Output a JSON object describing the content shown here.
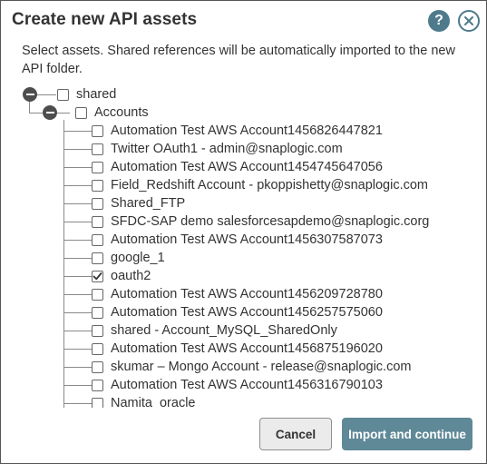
{
  "dialog": {
    "title": "Create new API assets",
    "description": "Select assets. Shared references will be automatically imported to the new API folder.",
    "help_icon": "question-mark-icon",
    "close_icon": "close-circle-icon"
  },
  "tree": {
    "root": {
      "label": "shared",
      "expanded": true,
      "checked": false
    },
    "folder": {
      "label": "Accounts",
      "expanded": true,
      "checked": false
    },
    "items": [
      {
        "label": "Automation Test AWS Account1456826447821",
        "checked": false
      },
      {
        "label": "Twitter OAuth1 - admin@snaplogic.com",
        "checked": false
      },
      {
        "label": "Automation Test AWS Account1454745647056",
        "checked": false
      },
      {
        "label": "Field_Redshift Account - pkoppishetty@snaplogic.com",
        "checked": false
      },
      {
        "label": "Shared_FTP",
        "checked": false
      },
      {
        "label": "SFDC-SAP demo salesforcesapdemo@snaplogic.corg",
        "checked": false
      },
      {
        "label": "Automation Test AWS Account1456307587073",
        "checked": false
      },
      {
        "label": "google_1",
        "checked": false
      },
      {
        "label": "oauth2",
        "checked": true
      },
      {
        "label": "Automation Test AWS Account1456209728780",
        "checked": false
      },
      {
        "label": "Automation Test AWS Account1456257575060",
        "checked": false
      },
      {
        "label": "shared - Account_MySQL_SharedOnly",
        "checked": false
      },
      {
        "label": "Automation Test AWS Account1456875196020",
        "checked": false
      },
      {
        "label": "skumar – Mongo Account - release@snaplogic.com",
        "checked": false
      },
      {
        "label": "Automation Test AWS Account1456316790103",
        "checked": false
      },
      {
        "label": "Namita_oracle",
        "checked": false
      }
    ]
  },
  "buttons": {
    "cancel": "Cancel",
    "import": "Import and continue"
  },
  "colors": {
    "accent": "#4e7a8c",
    "primary_button": "#5f8997",
    "toggle": "#4d4d4d"
  }
}
